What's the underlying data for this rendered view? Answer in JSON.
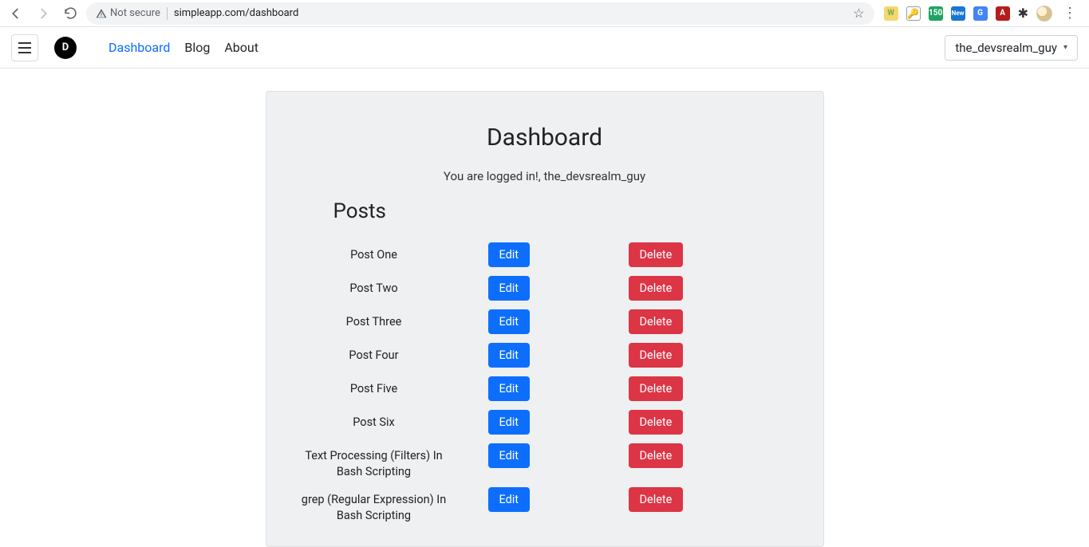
{
  "browser": {
    "security_label": "Not secure",
    "url": "simpleapp.com/dashboard"
  },
  "nav": {
    "links": [
      "Dashboard",
      "Blog",
      "About"
    ],
    "active_index": 0,
    "user_label": "the_devsrealm_guy"
  },
  "page": {
    "title": "Dashboard",
    "welcome_prefix": "You are logged in!, ",
    "welcome_user": "the_devsrealm_guy",
    "posts_heading": "Posts",
    "edit_label": "Edit",
    "delete_label": "Delete",
    "posts": [
      {
        "title": "Post One"
      },
      {
        "title": "Post Two"
      },
      {
        "title": "Post Three"
      },
      {
        "title": "Post Four"
      },
      {
        "title": "Post Five"
      },
      {
        "title": "Post Six"
      },
      {
        "title": "Text Processing (Filters) In Bash Scripting"
      },
      {
        "title": "grep (Regular Expression) In Bash Scripting"
      }
    ]
  }
}
